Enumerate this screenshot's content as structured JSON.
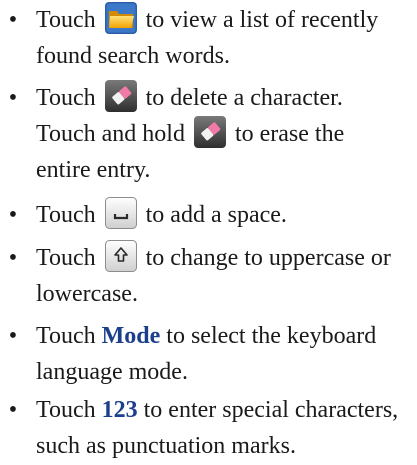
{
  "items": [
    {
      "pre": "Touch",
      "post": "to view a list of recently",
      "line2": "found search words."
    },
    {
      "pre": "Touch",
      "post": "to delete a character.",
      "line2a": "Touch and hold",
      "line2b": "to erase the",
      "line3": "entire entry."
    },
    {
      "pre": "Touch",
      "post": "to add a space."
    },
    {
      "pre": "Touch",
      "post": "to change to uppercase or",
      "line2": "lowercase."
    },
    {
      "pre": "Touch",
      "kw": "Mode",
      "post": "to select the keyboard",
      "line2": "language mode."
    },
    {
      "pre": "Touch",
      "kw": "123",
      "post": "to enter special characters,",
      "line2": "such as punctuation marks."
    }
  ],
  "icons": [
    "folder-icon",
    "eraser-icon",
    "eraser-icon",
    "space-key-icon",
    "shift-key-icon"
  ],
  "colors": {
    "keyword": "#1b3f8a",
    "text": "#1a1a1a"
  }
}
